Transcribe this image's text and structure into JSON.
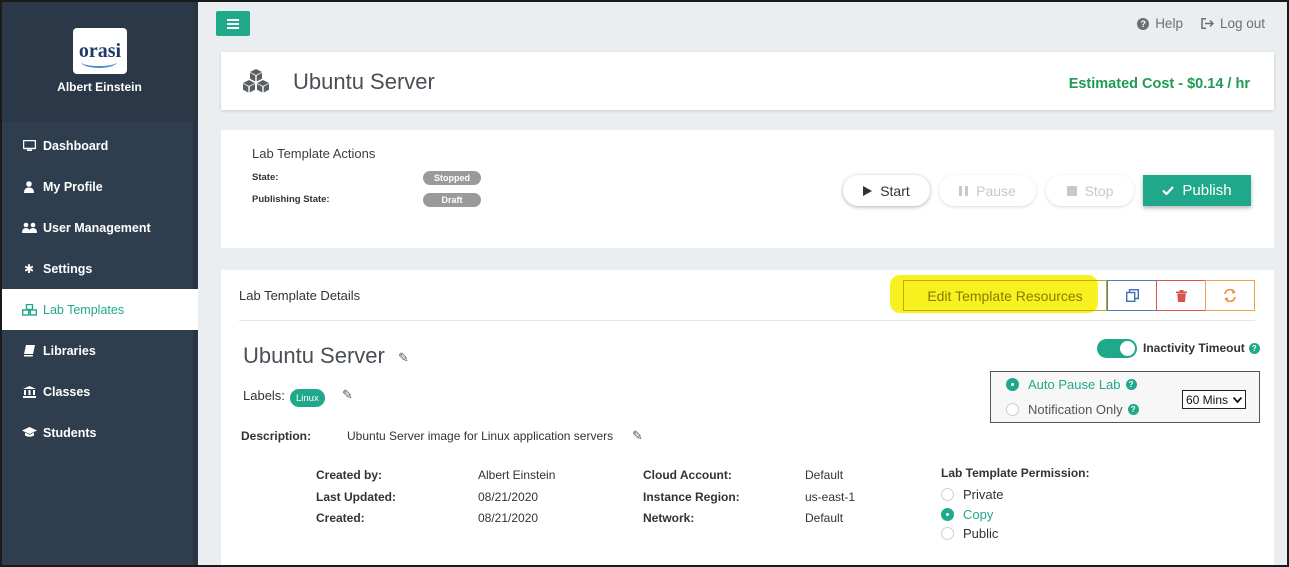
{
  "sidebar": {
    "user_name": "Albert Einstein",
    "logo_text": "orasi",
    "items": [
      {
        "label": "Dashboard",
        "icon": "monitor-icon"
      },
      {
        "label": "My Profile",
        "icon": "user-icon"
      },
      {
        "label": "User Management",
        "icon": "users-icon"
      },
      {
        "label": "Settings",
        "icon": "gear-icon"
      },
      {
        "label": "Lab Templates",
        "icon": "cubes-icon",
        "active": true
      },
      {
        "label": "Libraries",
        "icon": "book-icon"
      },
      {
        "label": "Classes",
        "icon": "institution-icon"
      },
      {
        "label": "Students",
        "icon": "graduation-cap-icon"
      }
    ]
  },
  "topbar": {
    "help_label": "Help",
    "logout_label": "Log out"
  },
  "header": {
    "title": "Ubuntu Server",
    "cost": "Estimated Cost - $0.14 / hr"
  },
  "actions": {
    "title": "Lab Template Actions",
    "state_label": "State:",
    "state_value": "Stopped",
    "publishing_label": "Publishing State:",
    "publishing_value": "Draft",
    "start_label": "Start",
    "pause_label": "Pause",
    "stop_label": "Stop",
    "publish_label": "Publish"
  },
  "details": {
    "title": "Lab Template Details",
    "edit_resources_label": "Edit Template Resources",
    "template_name": "Ubuntu Server",
    "labels_label": "Labels:",
    "tag": "Linux",
    "description_label": "Description:",
    "description_value": "Ubuntu Server image for Linux application servers",
    "meta_left": [
      {
        "key": "Created by:",
        "value": "Albert Einstein"
      },
      {
        "key": "Last Updated:",
        "value": "08/21/2020"
      },
      {
        "key": "Created:",
        "value": "08/21/2020"
      }
    ],
    "meta_right": [
      {
        "key": "Cloud Account:",
        "value": "Default"
      },
      {
        "key": "Instance Region:",
        "value": "us-east-1"
      },
      {
        "key": "Network:",
        "value": "Default"
      }
    ],
    "permission": {
      "title": "Lab Template Permission:",
      "options": [
        "Private",
        "Copy",
        "Public"
      ],
      "selected": "Copy"
    },
    "inactivity": {
      "label": "Inactivity Timeout",
      "enabled": true,
      "auto_pause_label": "Auto Pause Lab",
      "notification_label": "Notification Only",
      "selected_mode": "Auto Pause Lab",
      "duration": "60 Mins"
    }
  },
  "colors": {
    "accent": "#1fa98a",
    "sidebar_bg": "#2f3e4e",
    "cost_green": "#1e9b52",
    "highlight": "#f7f21f"
  }
}
